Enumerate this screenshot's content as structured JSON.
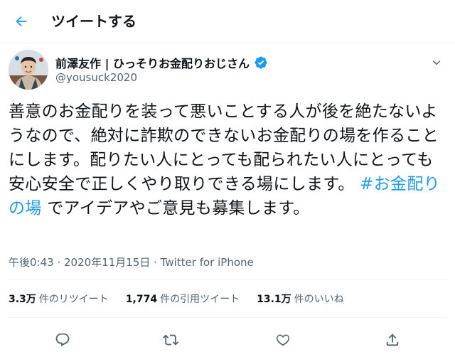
{
  "header": {
    "title": "ツイートする",
    "back_icon": "arrow-left-icon"
  },
  "author": {
    "display_name": "前澤友作 | ひっそりお金配りおじさん",
    "handle": "@yousuck2020",
    "verified": true
  },
  "tweet": {
    "text_before": "善意のお金配りを装って悪いことする人が後を絶たないようなので、絶対に詐欺のできないお金配りの場を作ることにします。配りたい人にとっても配られたい人にとっても安心安全で正しくやり取りできる場にします。 ",
    "hashtag": "#お金配りの場",
    "text_after": " でアイデアやご意見も募集します。"
  },
  "meta": {
    "time": "午後0:43",
    "separator": " · ",
    "date": "2020年11月15日",
    "source": "Twitter for iPhone"
  },
  "stats": [
    {
      "count": "3.3万",
      "label": "件のリツイート"
    },
    {
      "count": "1,774",
      "label": "件の引用ツイート"
    },
    {
      "count": "13.1万",
      "label": "件のいいね"
    }
  ],
  "colors": {
    "accent": "#1d9bf0",
    "secondary_text": "#536471",
    "divider": "#eff3f4"
  }
}
